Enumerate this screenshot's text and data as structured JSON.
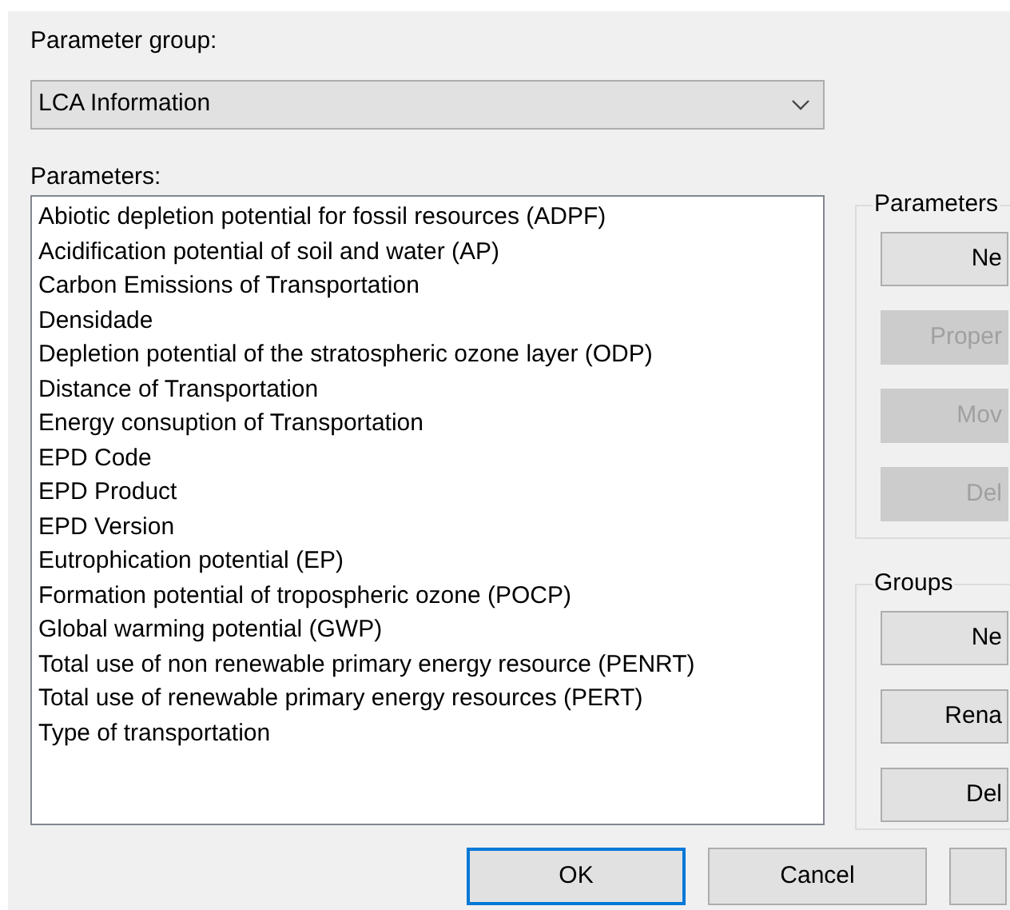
{
  "parameter_group": {
    "label": "Parameter group:",
    "value": "LCA Information"
  },
  "parameters": {
    "label": "Parameters:",
    "items": [
      "Abiotic depletion potential for fossil resources (ADPF)",
      "Acidification potential of soil and water (AP)",
      "Carbon Emissions of Transportation",
      "Densidade",
      "Depletion potential of the stratospheric ozone layer (ODP)",
      "Distance of Transportation",
      "Energy consuption of Transportation",
      "EPD Code",
      "EPD Product",
      "EPD Version",
      "Eutrophication potential (EP)",
      "Formation potential of tropospheric ozone (POCP)",
      "Global warming potential (GWP)",
      "Total use of non renewable primary energy resource (PENRT)",
      "Total use of renewable primary energy resources (PERT)",
      "Type of transportation"
    ]
  },
  "side_groups": [
    {
      "title": "Parameters",
      "buttons": [
        {
          "label": "Ne",
          "disabled": false
        },
        {
          "label": "Proper",
          "disabled": true
        },
        {
          "label": "Mov",
          "disabled": true
        },
        {
          "label": "Del",
          "disabled": true
        }
      ]
    },
    {
      "title": "Groups",
      "buttons": [
        {
          "label": "Ne",
          "disabled": false
        },
        {
          "label": "Rena",
          "disabled": false
        },
        {
          "label": "Del",
          "disabled": false
        }
      ]
    }
  ],
  "footer_buttons": [
    {
      "label": "OK",
      "default": true
    },
    {
      "label": "Cancel",
      "default": false
    },
    {
      "default": false
    }
  ]
}
